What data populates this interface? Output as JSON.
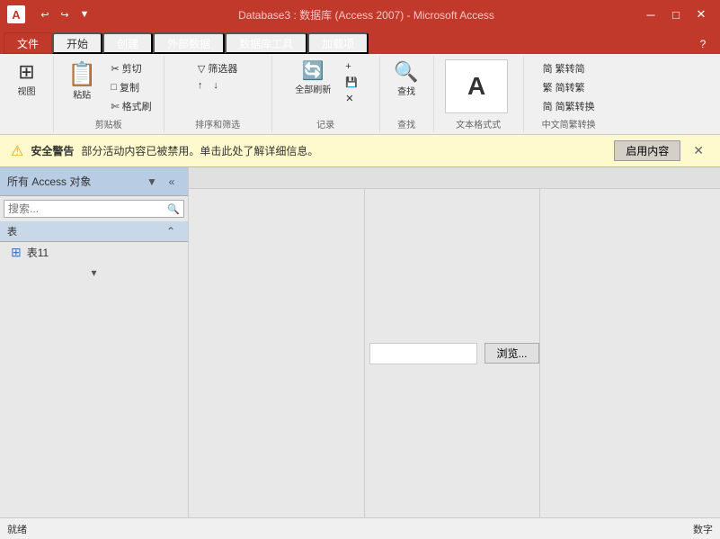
{
  "titleBar": {
    "logo": "A",
    "title": "Database3 : 数据库 (Access 2007)  -  Microsoft Access",
    "minimizeLabel": "─",
    "maximizeLabel": "□",
    "closeLabel": "✕",
    "quickAccess": [
      "↩",
      "↪",
      "▼"
    ]
  },
  "ribbon": {
    "tabs": [
      "文件",
      "开始",
      "创建",
      "外部数据",
      "数据库工具",
      "加载项"
    ],
    "activeTab": "开始",
    "groups": {
      "view": {
        "label": "视图",
        "icon": "⊞"
      },
      "clipboard": {
        "label": "剪贴板",
        "icons": [
          "✂",
          "□",
          "✄"
        ]
      },
      "filter": {
        "label": "排序和筛选"
      },
      "records": {
        "label": "记录"
      },
      "find": {
        "label": "查找"
      },
      "textFormat": {
        "label": "文本格式式",
        "mainLabel": "A"
      },
      "chineseConvert": {
        "label": "中文简繁转换",
        "items": [
          "简 繁转简",
          "繁 简转繁",
          "简 简繁转换"
        ]
      }
    }
  },
  "security": {
    "icon": "⚠",
    "label": "安全警告",
    "message": "部分活动内容已被禁用。单击此处了解详细信息。",
    "buttonLabel": "启用内容",
    "closeLabel": "✕"
  },
  "navPanel": {
    "title": "所有 Access 对象",
    "searchPlaceholder": "搜索...",
    "collapseIcon": "«",
    "dropdownIcon": "▼",
    "section": "表",
    "sectionIcon": "⌃",
    "items": [
      {
        "name": "表11",
        "icon": "⊞"
      }
    ],
    "expandIcon": "▾"
  },
  "content": {
    "browseLabel": "浏览..."
  },
  "statusBar": {
    "left": "就绪",
    "right": "数字"
  }
}
